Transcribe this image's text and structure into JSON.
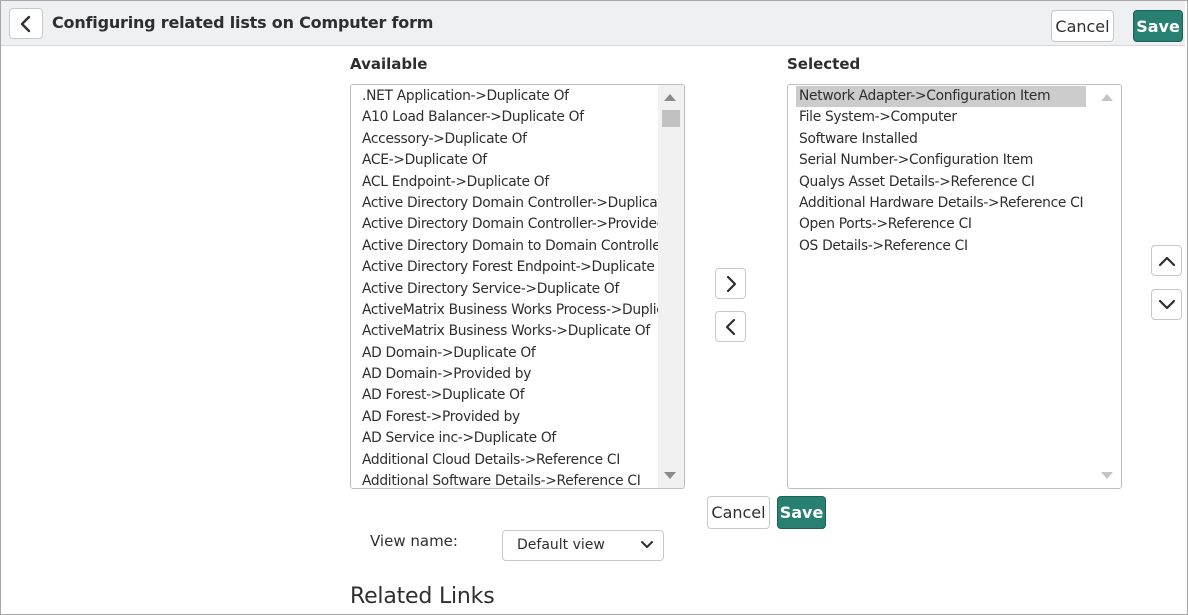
{
  "header": {
    "title": "Configuring related lists on Computer form",
    "cancel_label": "Cancel",
    "save_label": "Save",
    "back_icon": "chevron-left-icon"
  },
  "available": {
    "label": "Available",
    "items": [
      ".NET Application->Duplicate Of",
      "A10 Load Balancer->Duplicate Of",
      "Accessory->Duplicate Of",
      "ACE->Duplicate Of",
      "ACL Endpoint->Duplicate Of",
      "Active Directory Domain Controller->Duplicate Of",
      "Active Directory Domain Controller->Provided by",
      "Active Directory Domain to Domain Controller",
      "Active Directory Forest Endpoint->Duplicate Of",
      "Active Directory Service->Duplicate Of",
      "ActiveMatrix Business Works Process->Duplicate Of",
      "ActiveMatrix Business Works->Duplicate Of",
      "AD Domain->Duplicate Of",
      "AD Domain->Provided by",
      "AD Forest->Duplicate Of",
      "AD Forest->Provided by",
      "AD Service inc->Duplicate Of",
      "Additional Cloud Details->Reference CI",
      "Additional Software Details->Reference CI"
    ]
  },
  "selected": {
    "label": "Selected",
    "items": [
      "Network Adapter->Configuration Item",
      "File System->Computer",
      "Software Installed",
      "Serial Number->Configuration Item",
      "Qualys Asset Details->Reference CI",
      "Additional Hardware Details->Reference CI",
      "Open Ports->Reference CI",
      "OS Details->Reference CI"
    ],
    "highlighted_index": 0
  },
  "footer": {
    "cancel_label": "Cancel",
    "save_label": "Save",
    "view_name_label": "View name:",
    "view_name_value": "Default view",
    "related_links_heading": "Related Links"
  },
  "colors": {
    "primary": "#278072",
    "header_bg": "#eef0f1",
    "selected_row": "#cccccc"
  }
}
